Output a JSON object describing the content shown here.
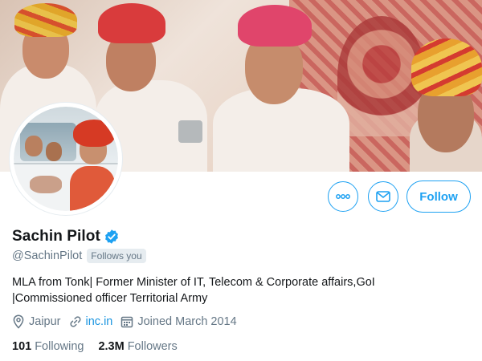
{
  "profile": {
    "display_name": "Sachin Pilot",
    "handle": "@SachinPilot",
    "follows_you": "Follows you",
    "bio_line1": "MLA from Tonk| Former Minister of IT, Telecom & Corporate affairs,GoI",
    "bio_line2": "|Commissioned officer Territorial Army",
    "location": "Jaipur",
    "website": "inc.in",
    "joined": "Joined March 2014",
    "following_count": "101",
    "following_label": "Following",
    "followers_count": "2.3M",
    "followers_label": "Followers"
  },
  "actions": {
    "follow_label": "Follow"
  },
  "icons": {
    "more": "more-options-icon",
    "message": "envelope-icon",
    "verified": "verified-badge-icon",
    "location": "location-pin-icon",
    "link": "link-icon",
    "calendar": "calendar-icon"
  },
  "colors": {
    "accent": "#1da1f2",
    "link": "#1b95e0",
    "secondary_text": "#657786",
    "primary_text": "#14171a"
  }
}
